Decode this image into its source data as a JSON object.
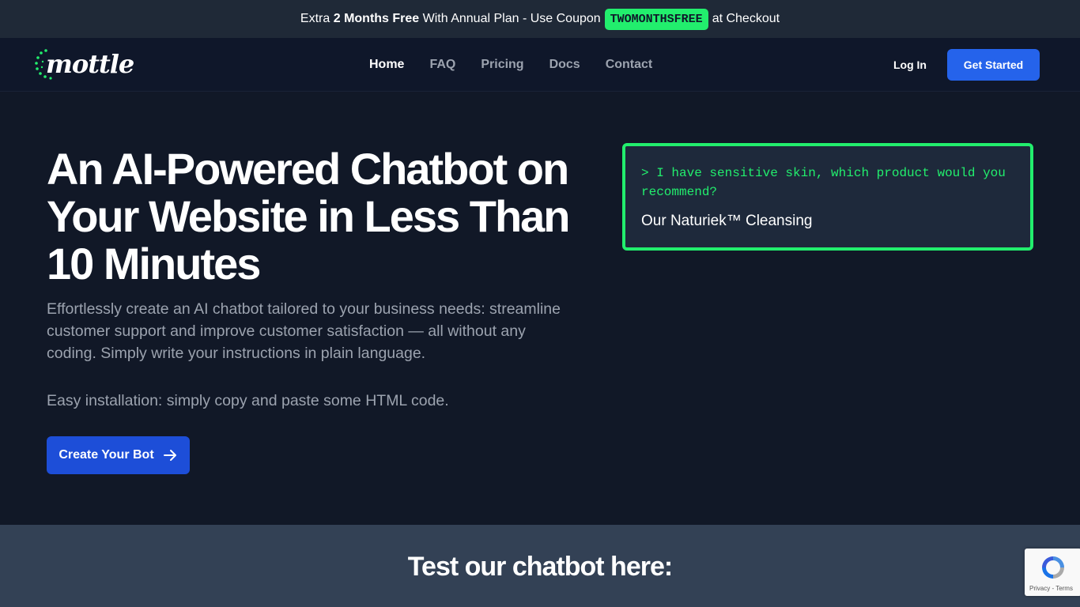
{
  "promo": {
    "prefix": "Extra",
    "highlight": "2 Months Free",
    "middle": "With Annual Plan - Use Coupon",
    "coupon": "TWOMONTHSFREE",
    "suffix": "at Checkout"
  },
  "brand": {
    "logo_text": "mottle",
    "accent_color": "#22ee6d"
  },
  "nav": {
    "items": [
      {
        "label": "Home",
        "active": true
      },
      {
        "label": "FAQ"
      },
      {
        "label": "Pricing"
      },
      {
        "label": "Docs"
      },
      {
        "label": "Contact"
      }
    ],
    "login_label": "Log In",
    "get_started_label": "Get Started"
  },
  "hero": {
    "title": "An AI-Powered Chatbot on Your Website in Less Than 10 Minutes",
    "description": "Effortlessly create an AI chatbot tailored to your business needs: streamline customer support and improve customer satisfaction — all without any coding. Simply write your instructions in plain language.",
    "install_note": "Easy installation: simply copy and paste some HTML code.",
    "cta_label": "Create Your Bot",
    "cta_icon": "arrow-right-icon"
  },
  "demo_terminal": {
    "prompt": "> I have sensitive skin, which product would you recommend?",
    "answer": "Our Naturiek™ Cleansing"
  },
  "test_section": {
    "title": "Test our chatbot here:"
  },
  "recaptcha": {
    "links": "Privacy - Terms"
  }
}
